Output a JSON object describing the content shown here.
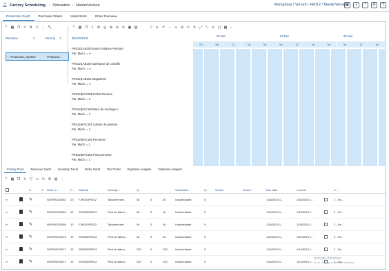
{
  "app": {
    "title": "Factory Scheduling",
    "breadcrumb": [
      "Simulation",
      "MasterVersion"
    ],
    "workgroup": "Workgroup / Version: FR012 / MasterVersion"
  },
  "top_tabs": [
    "Production Gantt",
    "Purchase Orders",
    "Initial Stock",
    "Order Overview"
  ],
  "left_pane": {
    "col_resource": "Resource",
    "col_description": "Descrip",
    "row_name": "Production_System",
    "row_desc": "Productio..."
  },
  "resources": {
    "title": "RESOURCE",
    "items": [
      {
        "name": "FR012|LAB100 Sous-Traitance Peinture",
        "meta": "Par. Mach. = ∞"
      },
      {
        "name": "FR012|LAB100 Opérateur de contrôle",
        "meta": "Par. Mach. = ∞"
      },
      {
        "name": "FR012|LAB101 Magasinier",
        "meta": "Par. Mach. = ∞"
      },
      {
        "name": "FR012|MAC095 Robot Peinture",
        "meta": "Par. Mach. = 1"
      },
      {
        "name": "FR012|MAC100 Banc de montage A",
        "meta": "Par. Mach. = 1"
      },
      {
        "name": "FR012|MAC101 Cabine de peinture",
        "meta": "Par. Mach. = 1"
      },
      {
        "name": "FR012|MAC102 Perceuse",
        "meta": "Par. Mach. = 1"
      },
      {
        "name": "FR012|MAC103 Poinçonneuse",
        "meta": "Par. Mach. = 1"
      }
    ]
  },
  "gantt": {
    "dates": [
      "03 Nov",
      "04 Nov",
      "05 Nov"
    ],
    "hours": [
      "00",
      "06",
      "12",
      "18",
      "00",
      "06",
      "12",
      "18",
      "00",
      "06",
      "12",
      "18"
    ]
  },
  "bottom_tabs": [
    "Picking Pond",
    "Resource Gantt",
    "Inventory Trend",
    "Order Gantt",
    "Tool Trend",
    "Explosion Analysis",
    "Implosion Analysis"
  ],
  "table": {
    "headers": [
      "S...",
      "Work or...",
      "P...",
      "Material",
      "Descript...",
      "Q...",
      "Scheduled",
      "Q...",
      "Sched...",
      "Sched...",
      "Due date",
      "Launch...",
      "S..."
    ],
    "rows": [
      [
        "WOFR0120061",
        "10",
        "FJN001FR012",
        "Tabouret mét...",
        "40",
        "0",
        "40",
        "Unscheduled",
        "0",
        "1/16/2024 1...",
        "1/16/2024 1...",
        "2 - Se..."
      ],
      [
        "WOFR0120062",
        "10",
        "SFE026FR012",
        "Pied de tabou...",
        "40",
        "0",
        "40",
        "Unscheduled",
        "0",
        "1/10/2024 1...",
        "1/10/2024 1...",
        "2 - Se..."
      ],
      [
        "WOFR0120069",
        "10",
        "FJN001FR012",
        "Tabouret mét...",
        "40",
        "0",
        "40",
        "Unscheduled",
        "0",
        "1/26/2024 1...",
        "1/26/2024 1...",
        "2 - Se..."
      ],
      [
        "WOFR0120070",
        "10",
        "SFE026FR012",
        "Pied de tabou...",
        "40",
        "0",
        "40",
        "Unscheduled",
        "0",
        "1/22/2024 1...",
        "1/22/2024 1...",
        "2 - Se..."
      ],
      [
        "WOFR0120071",
        "10",
        "SFE026FR012",
        "Pied de tabou...",
        "220",
        "0",
        "220",
        "Unscheduled",
        "0",
        "1/14/2024 1...",
        "1/14/2024 1...",
        "2 - Se..."
      ],
      [
        "WOFR0120071",
        "10",
        "SFE026FR012",
        "Pied de tabou...",
        "220",
        "0",
        "220",
        "Unscheduled",
        "0",
        "1/14/2024 1...",
        "1/14/2024 1...",
        "2 - Se..."
      ]
    ]
  },
  "watermark": {
    "line1": "Activate Windows",
    "line2": "Go to Settings to activate Windows."
  }
}
